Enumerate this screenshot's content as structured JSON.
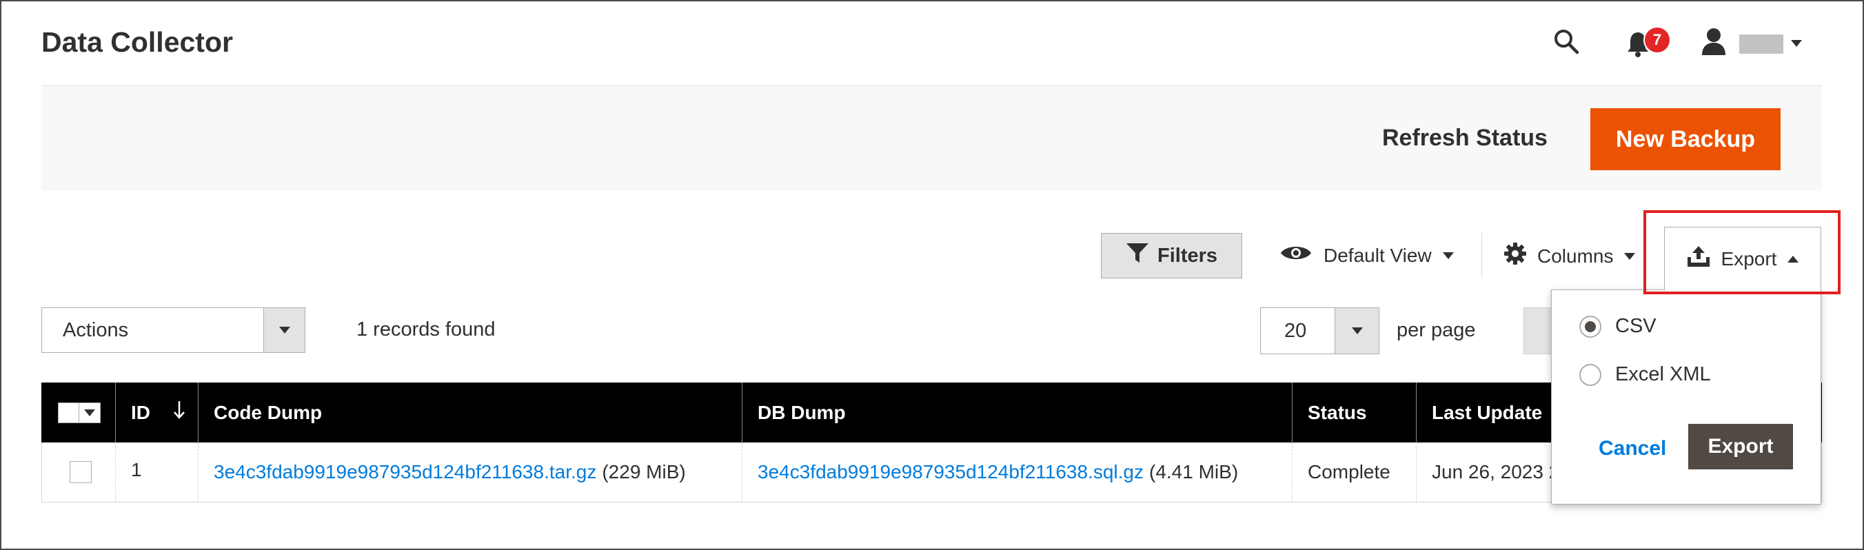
{
  "header": {
    "title": "Data Collector",
    "notifications_count": "7"
  },
  "action_bar": {
    "refresh_label": "Refresh Status",
    "new_backup_label": "New Backup"
  },
  "toolbar": {
    "filters_label": "Filters",
    "view_label": "Default View",
    "columns_label": "Columns",
    "export_label": "Export"
  },
  "mass_actions": {
    "selected": "Actions"
  },
  "records_found": "1 records found",
  "pagination": {
    "per_page_value": "20",
    "per_page_label": "per page"
  },
  "table": {
    "columns": [
      "ID",
      "Code Dump",
      "DB Dump",
      "Status",
      "Last Update"
    ],
    "rows": [
      {
        "id": "1",
        "code_dump_link": "3e4c3fdab9919e987935d124bf211638.tar.gz",
        "code_dump_size": "(229 MiB)",
        "db_dump_link": "3e4c3fdab9919e987935d124bf211638.sql.gz",
        "db_dump_size": "(4.41 MiB)",
        "status": "Complete",
        "last_update": "Jun 26, 2023 2"
      }
    ]
  },
  "export_menu": {
    "options": [
      "CSV",
      "Excel XML"
    ],
    "selected": "CSV",
    "cancel_label": "Cancel",
    "export_label": "Export"
  },
  "colors": {
    "primary": "#eb5202",
    "link": "#007bdb",
    "badge": "#e22626",
    "highlight": "#e0201f"
  }
}
